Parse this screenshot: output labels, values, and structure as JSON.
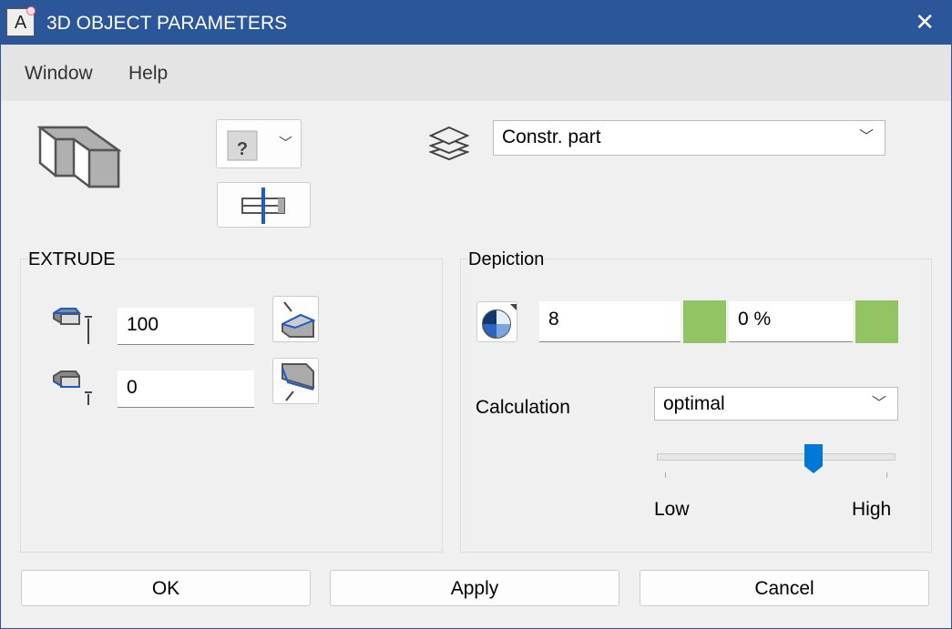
{
  "window": {
    "title": "3D OBJECT PARAMETERS",
    "app_icon_letter": "A"
  },
  "menu": {
    "items": [
      "Window",
      "Help"
    ]
  },
  "layer": {
    "selected": "Constr. part"
  },
  "extrude": {
    "label": "EXTRUDE",
    "top_value": "100",
    "bottom_value": "0"
  },
  "depiction": {
    "label": "Depiction",
    "segments_value": "8",
    "transparency_value": "0 %",
    "swatch_color": "#92c463",
    "calculation_label": "Calculation",
    "calculation_selected": "optimal",
    "slider": {
      "value_fraction": 0.67,
      "low_label": "Low",
      "high_label": "High"
    }
  },
  "buttons": {
    "ok": "OK",
    "apply": "Apply",
    "cancel": "Cancel"
  },
  "colors": {
    "titlebar": "#2b579a",
    "accent": "#0078d7"
  }
}
